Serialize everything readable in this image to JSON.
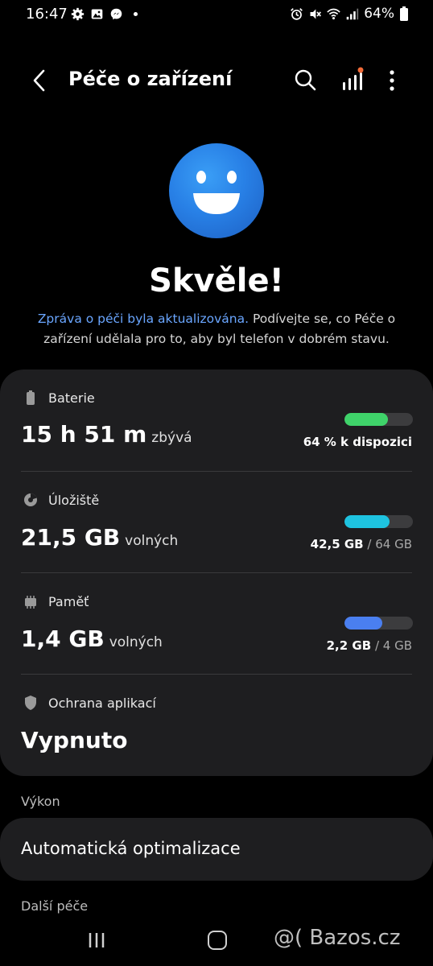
{
  "status_bar": {
    "time": "16:47",
    "battery": "64%",
    "icons": [
      "gear-icon",
      "gallery-icon",
      "messenger-icon",
      "dot-icon",
      "alarm-icon",
      "mute-icon",
      "wifi-icon",
      "signal-icon",
      "battery-icon"
    ]
  },
  "app_bar": {
    "title": "Péče o zařízení"
  },
  "hero": {
    "headline": "Skvěle!",
    "link_text": "Zpráva o péči byla aktualizována.",
    "body_text": " Podívejte se, co Péče o zařízení udělala pro to, aby byl telefon v dobrém stavu."
  },
  "battery": {
    "label": "Baterie",
    "value": "15 h 51 m",
    "unit": "zbývá",
    "caption": "64 % k dispozici",
    "percent": 64,
    "color": "#3fd36a"
  },
  "storage": {
    "label": "Úložiště",
    "value": "21,5 GB",
    "unit": "volných",
    "used": "42,5 GB",
    "total": "/ 64 GB",
    "percent": 66,
    "color": "#1ec3e0"
  },
  "memory": {
    "label": "Paměť",
    "value": "1,4 GB",
    "unit": "volných",
    "used": "2,2 GB",
    "total": "/ 4 GB",
    "percent": 55,
    "color": "#4a7ff0"
  },
  "app_protection": {
    "label": "Ochrana aplikací",
    "value": "Vypnuto"
  },
  "performance": {
    "section_label": "Výkon",
    "item_label": "Automatická optimalizace"
  },
  "more_care": {
    "section_label": "Další péče"
  },
  "watermark": "@( Bazos.cz"
}
